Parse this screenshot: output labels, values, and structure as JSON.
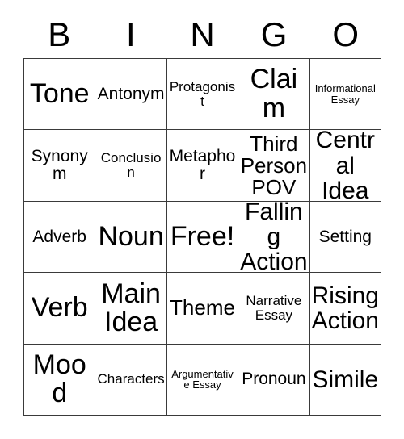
{
  "card": {
    "header_letters": [
      "B",
      "I",
      "N",
      "G",
      "O"
    ],
    "columns": 5,
    "rows": 5,
    "border_color": "#3a3a3a",
    "background_color": "#ffffff",
    "text_color": "#000000",
    "cells": [
      {
        "text": "Tone",
        "size": "fs-xl",
        "free": false
      },
      {
        "text": "Antonym",
        "size": "fs-sm",
        "free": false
      },
      {
        "text": "Protagonist",
        "size": "fs-xs",
        "free": false
      },
      {
        "text": "Claim",
        "size": "fs-xl",
        "free": false
      },
      {
        "text": "Informational Essay",
        "size": "fs-xxs",
        "free": false
      },
      {
        "text": "Synonym",
        "size": "fs-sm",
        "free": false
      },
      {
        "text": "Conclusion",
        "size": "fs-xs",
        "free": false
      },
      {
        "text": "Metaphor",
        "size": "fs-sm",
        "free": false
      },
      {
        "text": "Third Person POV",
        "size": "fs-md",
        "free": false
      },
      {
        "text": "Central Idea",
        "size": "fs-lg",
        "free": false
      },
      {
        "text": "Adverb",
        "size": "fs-sm",
        "free": false
      },
      {
        "text": "Noun",
        "size": "fs-xl",
        "free": false
      },
      {
        "text": "Free!",
        "size": "fs-xl",
        "free": true
      },
      {
        "text": "Falling Action",
        "size": "fs-lg",
        "free": false
      },
      {
        "text": "Setting",
        "size": "fs-sm",
        "free": false
      },
      {
        "text": "Verb",
        "size": "fs-xl",
        "free": false
      },
      {
        "text": "Main Idea",
        "size": "fs-xl",
        "free": false
      },
      {
        "text": "Theme",
        "size": "fs-md",
        "free": false
      },
      {
        "text": "Narrative Essay",
        "size": "fs-xs",
        "free": false
      },
      {
        "text": "Rising Action",
        "size": "fs-lg",
        "free": false
      },
      {
        "text": "Mood",
        "size": "fs-xl",
        "free": false
      },
      {
        "text": "Characters",
        "size": "fs-xs",
        "free": false
      },
      {
        "text": "Argumentative Essay",
        "size": "fs-xxs",
        "free": false
      },
      {
        "text": "Pronoun",
        "size": "fs-sm",
        "free": false
      },
      {
        "text": "Simile",
        "size": "fs-lg",
        "free": false
      }
    ]
  }
}
